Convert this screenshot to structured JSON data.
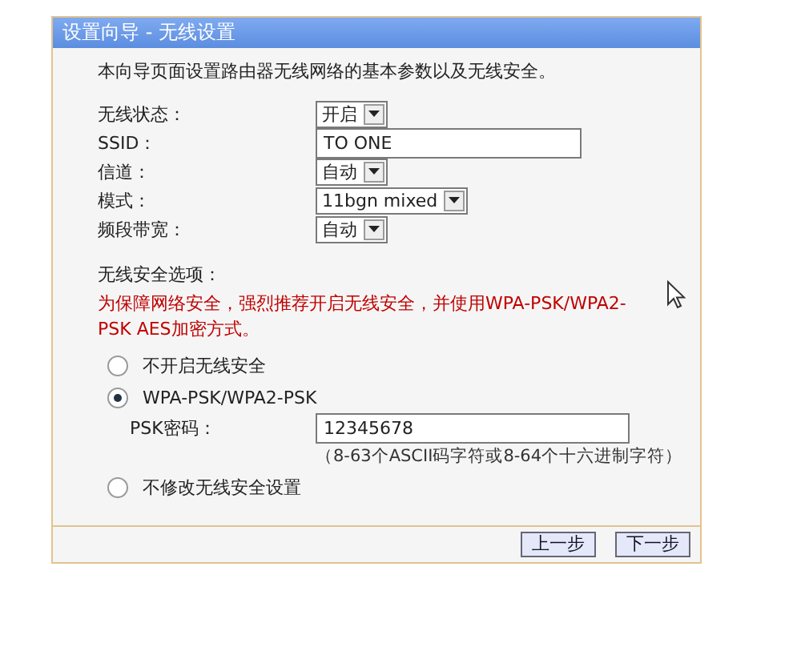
{
  "window": {
    "title": "设置向导 - 无线设置"
  },
  "intro": "本向导页面设置路由器无线网络的基本参数以及无线安全。",
  "fields": [
    {
      "label": "无线状态：",
      "kind": "select",
      "value": "开启"
    },
    {
      "label": "SSID：",
      "kind": "text",
      "value": "TO ONE"
    },
    {
      "label": "信道：",
      "kind": "select",
      "value": "自动"
    },
    {
      "label": "模式：",
      "kind": "select",
      "value": "11bgn mixed"
    },
    {
      "label": "频段带宽：",
      "kind": "select",
      "value": "自动"
    }
  ],
  "security": {
    "heading": "无线安全选项：",
    "warning": "为保障网络安全，强烈推荐开启无线安全，并使用WPA-PSK/WPA2-PSK AES加密方式。",
    "options": [
      {
        "label": "不开启无线安全",
        "selected": false
      },
      {
        "label": "WPA-PSK/WPA2-PSK",
        "selected": true,
        "psk": {
          "label": "PSK密码：",
          "value": "12345678",
          "hint": "（8-63个ASCII码字符或8-64个十六进制字符）"
        }
      },
      {
        "label": "不修改无线安全设置",
        "selected": false
      }
    ]
  },
  "buttons": [
    "上一步",
    "下一步"
  ]
}
